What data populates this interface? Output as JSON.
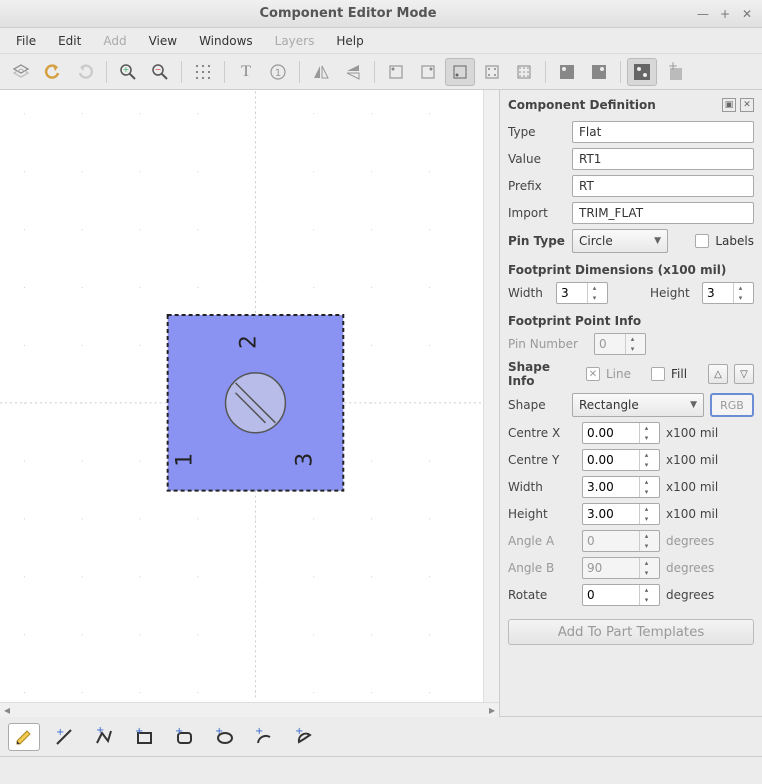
{
  "window": {
    "title": "Component Editor Mode"
  },
  "menu": {
    "file": "File",
    "edit": "Edit",
    "add": "Add",
    "view": "View",
    "windows": "Windows",
    "layers": "Layers",
    "help": "Help"
  },
  "sidebar": {
    "panel_title": "Component Definition",
    "type_label": "Type",
    "type_value": "Flat",
    "value_label": "Value",
    "value_value": "RT1",
    "prefix_label": "Prefix",
    "prefix_value": "RT",
    "import_label": "Import",
    "import_value": "TRIM_FLAT",
    "pintype_label": "Pin Type",
    "pintype_value": "Circle",
    "labels_label": "Labels",
    "dims_title": "Footprint Dimensions (x100 mil)",
    "width_label": "Width",
    "width_value": "3",
    "height_label": "Height",
    "height_value": "3",
    "pointinfo_title": "Footprint Point Info",
    "pinnum_label": "Pin Number",
    "pinnum_value": "0",
    "shapeinfo_label": "Shape Info",
    "line_label": "Line",
    "fill_label": "Fill",
    "shape_label": "Shape",
    "shape_value": "Rectangle",
    "rgb_label": "RGB",
    "cx_label": "Centre X",
    "cx_value": "0.00",
    "cy_label": "Centre Y",
    "cy_value": "0.00",
    "sw_label": "Width",
    "sw_value": "3.00",
    "sh_label": "Height",
    "sh_value": "3.00",
    "aa_label": "Angle A",
    "aa_value": "0",
    "ab_label": "Angle B",
    "ab_value": "90",
    "rot_label": "Rotate",
    "rot_value": "0",
    "unit_mil": "x100 mil",
    "unit_deg": "degrees",
    "add_button": "Add To Part Templates"
  },
  "canvas": {
    "pin1": "1",
    "pin2": "2",
    "pin3": "3",
    "accent": "#8b93f2",
    "shape_stroke": "#222"
  }
}
